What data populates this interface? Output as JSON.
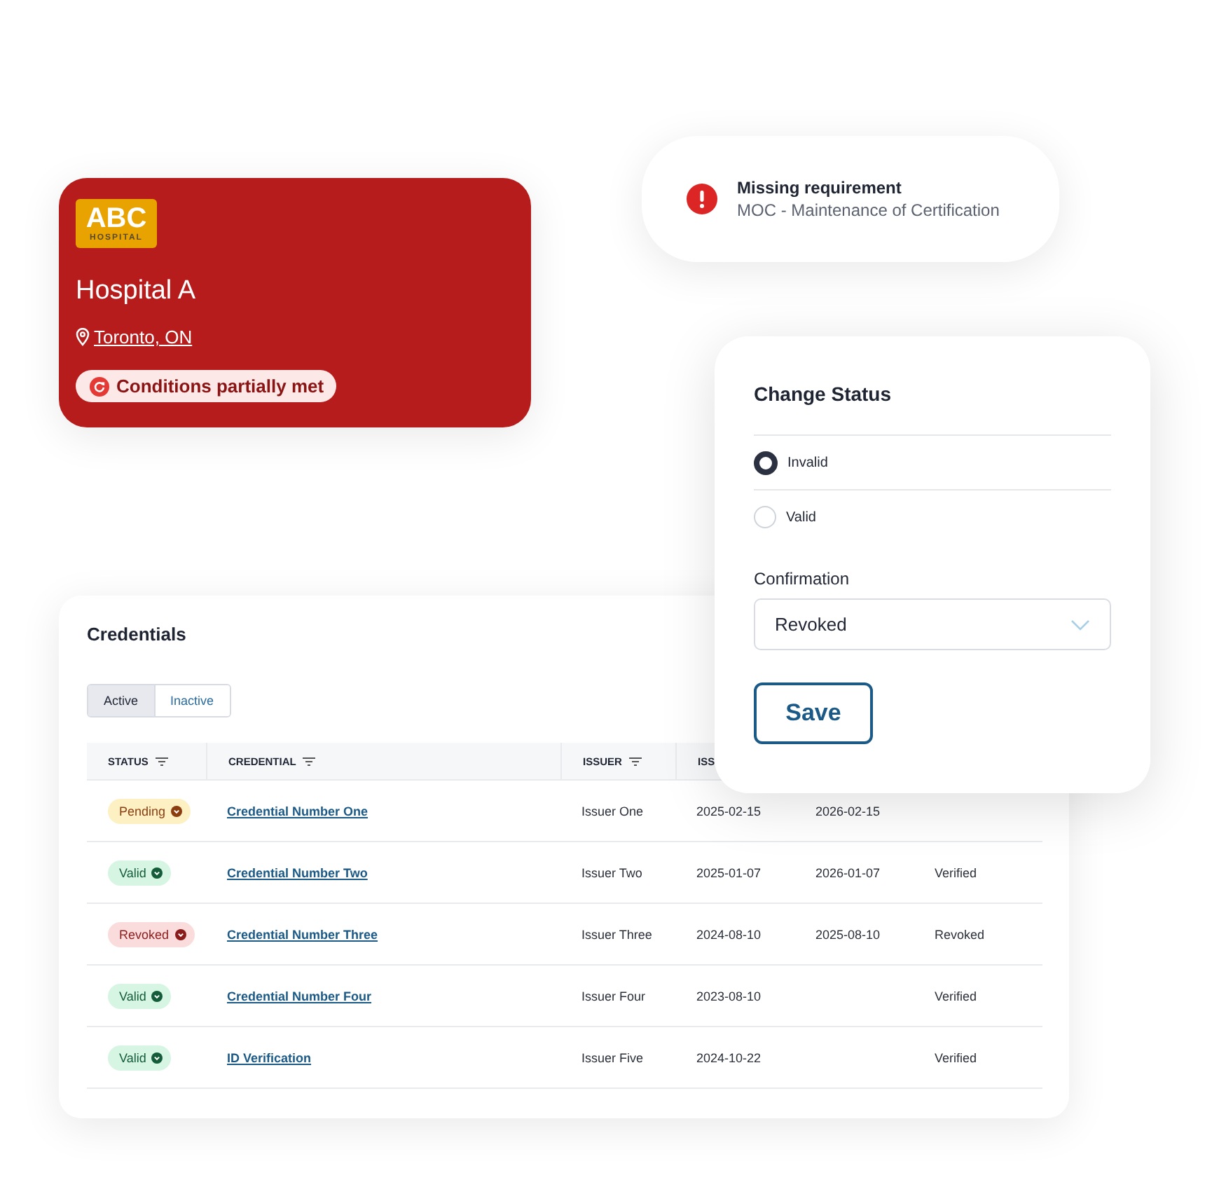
{
  "hospital_card": {
    "logo": {
      "main": "ABC",
      "sub": "HOSPITAL"
    },
    "name": "Hospital A",
    "location": "Toronto, ON",
    "status": "Conditions partially met"
  },
  "alert": {
    "title": "Missing requirement",
    "detail": "MOC - Maintenance of Certification"
  },
  "credentials": {
    "title": "Credentials",
    "tabs": [
      {
        "label": "Active",
        "selected": true
      },
      {
        "label": "Inactive",
        "selected": false
      }
    ],
    "columns": [
      "STATUS",
      "CREDENTIAL",
      "ISSUER",
      "ISS"
    ],
    "rows": [
      {
        "status": {
          "label": "Pending",
          "kind": "pending"
        },
        "credential": "Credential Number One",
        "issuer": "Issuer One",
        "column_4": "2025-02-15",
        "column_5": "2026-02-15"
      },
      {
        "status": {
          "label": "Valid",
          "kind": "valid"
        },
        "credential": "Credential Number Two",
        "issuer": "Issuer Two",
        "column_4": "2025-01-07",
        "column_5": "2026-01-07",
        "column_6": "Verified"
      },
      {
        "status": {
          "label": "Revoked",
          "kind": "revoked"
        },
        "credential": "Credential Number Three",
        "issuer": "Issuer Three",
        "column_4": "2024-08-10",
        "column_5": "2025-08-10",
        "column_6": "Revoked"
      },
      {
        "status": {
          "label": "Valid",
          "kind": "valid"
        },
        "credential": "Credential Number Four",
        "issuer": "Issuer Four",
        "column_4": "2023-08-10",
        "column_6": "Verified"
      },
      {
        "status": {
          "label": "Valid",
          "kind": "valid"
        },
        "credential": "ID Verification",
        "issuer": "Issuer Five",
        "column_4": "2024-10-22",
        "column_6": "Verified"
      }
    ]
  },
  "change_status": {
    "title": "Change Status",
    "options": [
      {
        "label": "Invalid",
        "selected": true
      },
      {
        "label": "Valid",
        "selected": false
      }
    ],
    "confirmation_label": "Confirmation",
    "confirmation_value": "Revoked",
    "save": "Save"
  }
}
